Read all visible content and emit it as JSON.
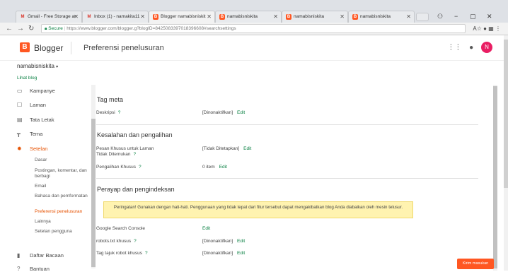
{
  "browser": {
    "tabs": [
      {
        "label": "Gmail - Free Storage ar",
        "favicon": "M",
        "color": "#d93025"
      },
      {
        "label": "Inbox (1) - namakita11",
        "favicon": "M",
        "color": "#d93025"
      },
      {
        "label": "Blogger namabisniskit",
        "favicon": "B",
        "color": "#ff5722"
      },
      {
        "label": "namabisniskita",
        "favicon": "B",
        "color": "#ff5722"
      },
      {
        "label": "namabisniskita",
        "favicon": "B",
        "color": "#ff5722"
      },
      {
        "label": "namabisniskita",
        "favicon": "B",
        "color": "#ff5722"
      }
    ],
    "secure_label": "Secure",
    "url": "https://www.blogger.com/blogger.g?blogID=8425083397018396608#searchsettings"
  },
  "header": {
    "logo_letter": "B",
    "app_name": "Blogger",
    "page_title": "Preferensi penelusuran",
    "avatar_letter": "N"
  },
  "blog": {
    "name": "namabisniskita",
    "view_link": "Lihat blog"
  },
  "sidebar": {
    "items": [
      {
        "label": "Kampanye",
        "icon": "megaphone-icon"
      },
      {
        "label": "Laman",
        "icon": "page-icon"
      },
      {
        "label": "Tata Letak",
        "icon": "layout-icon"
      },
      {
        "label": "Tema",
        "icon": "paint-roller-icon"
      },
      {
        "label": "Setelan",
        "icon": "gear-icon"
      }
    ],
    "subitems": [
      "Dasar",
      "Postingan, komentar, dan berbagi",
      "Email",
      "Bahasa dan pemformatan",
      "Preferensi penelusuran",
      "Lainnya",
      "Setelan pengguna"
    ],
    "bottom_items": [
      {
        "label": "Daftar Bacaan",
        "icon": "bookmark-icon"
      },
      {
        "label": "Bantuan",
        "icon": "help-icon"
      }
    ]
  },
  "sections": {
    "meta": {
      "title": "Tag meta",
      "desc_label": "Deskripsi",
      "desc_value": "[Dinonaktifkan]",
      "edit": "Edit"
    },
    "errors": {
      "title": "Kesalahan dan pengalihan",
      "custom_404_label": "Pesan Khusus untuk Laman Tidak Ditemukan",
      "custom_404_value": "[Tidak Ditetapkan]",
      "redirects_label": "Pengalihan Khusus",
      "redirects_value": "0 item",
      "edit": "Edit"
    },
    "crawlers": {
      "title": "Perayap dan pengindeksan",
      "warning": "Peringatan! Gunakan dengan hati-hati. Penggunaan yang tidak tepat dari fitur tersebut dapat mengakibatkan blog Anda diabaikan oleh mesin telusur.",
      "gsc_label": "Google Search Console",
      "robots_label": "robots.txt khusus",
      "robots_value": "[Dinonaktifkan]",
      "robots_header_label": "Tag tajuk robot khusus",
      "robots_header_value": "[Dinonaktifkan]",
      "edit": "Edit"
    }
  },
  "help_mark": "?",
  "feedback_button": "Kirim masukan"
}
